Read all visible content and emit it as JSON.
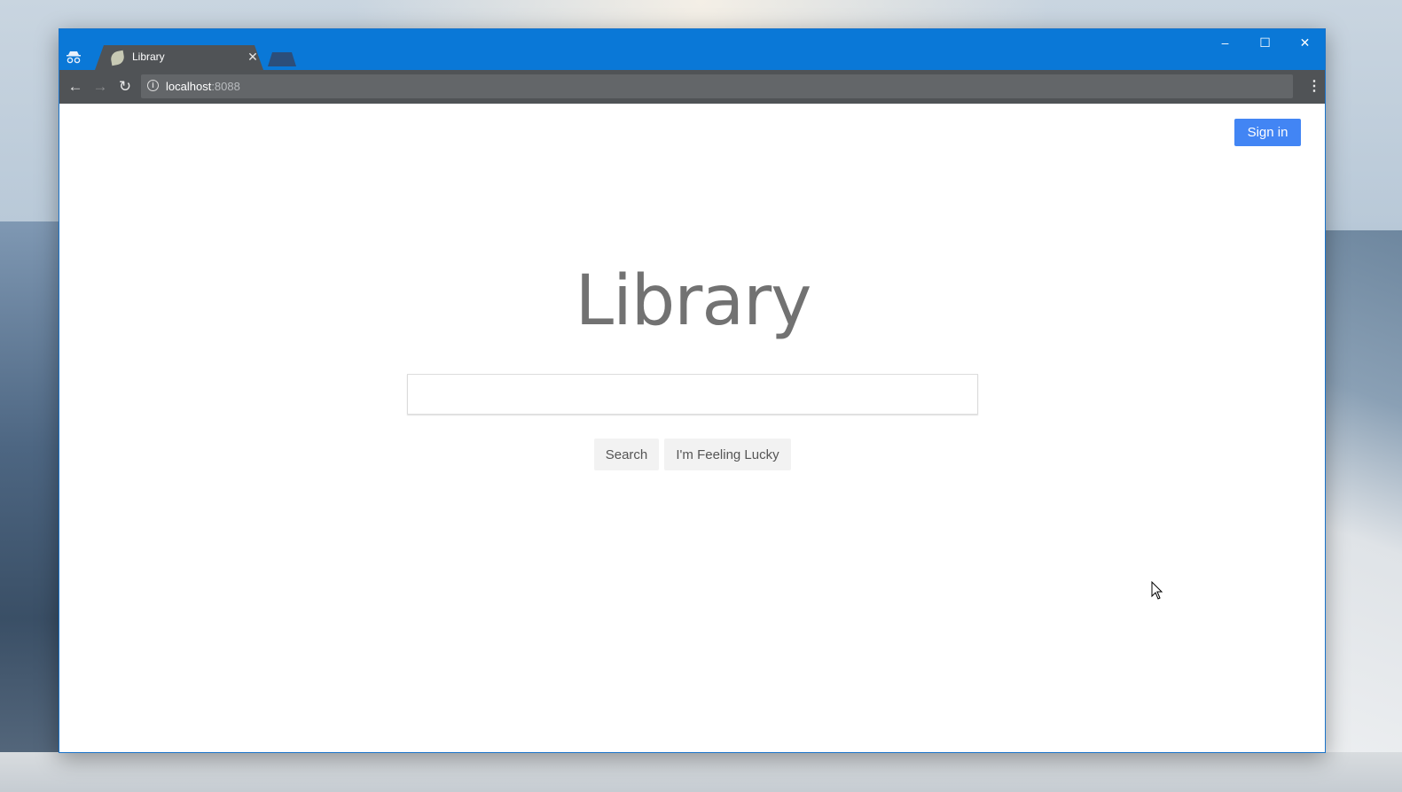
{
  "browser": {
    "tab_title": "Library",
    "tab_close": "✕",
    "window_controls": {
      "minimize": "–",
      "maximize": "☐",
      "close": "✕"
    },
    "nav": {
      "back": "←",
      "forward": "→",
      "reload": "↻"
    },
    "url_host": "localhost",
    "url_port": ":8088",
    "menu": "⋮"
  },
  "page": {
    "sign_in_label": "Sign in",
    "logo_text": "Library",
    "search_value": "",
    "search_button": "Search",
    "lucky_button": "I'm Feeling Lucky"
  },
  "colors": {
    "titlebar": "#0a78d7",
    "sign_in": "#4285f4",
    "logo": "#727272"
  }
}
